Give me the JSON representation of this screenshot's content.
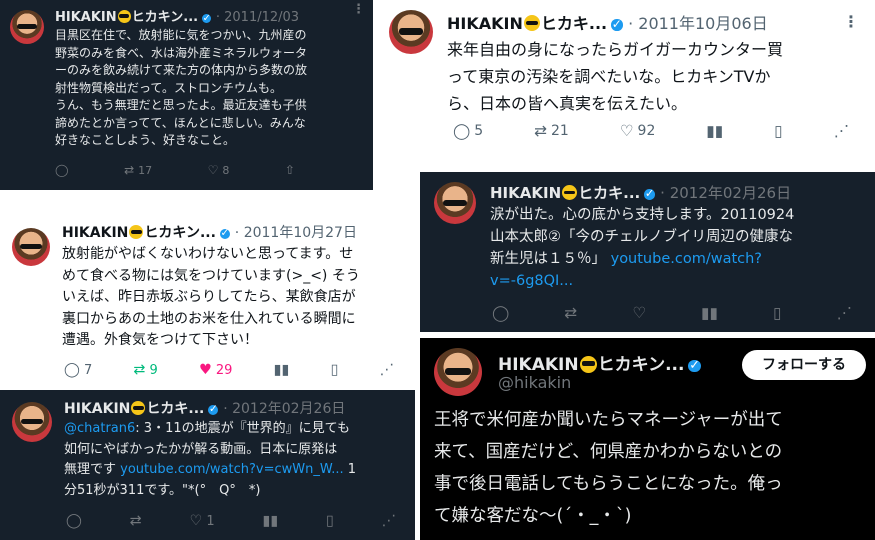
{
  "tweets": [
    {
      "name": "HIKAKIN",
      "name_suffix": "ヒカキン...",
      "date": "2011/12/03",
      "lines": [
        "目黒区在住で、放射能に気をつかい、九州産の",
        "野菜のみを食べ、水は海外産ミネラルウォータ",
        "ーのみを飲み続けて来た方の体内から多数の放",
        "射性物質検出だって。ストロンチウムも。",
        "うん、もう無理だと思ったよ。最近友達も子供",
        "諦めたとか言ってて、ほんとに悲しい。みんな",
        "好きなことしよう、好きなこと。"
      ],
      "reply": "",
      "retweet": "17",
      "like": "8"
    },
    {
      "name": "HIKAKIN",
      "name_suffix": "ヒカキ...",
      "date": "2011年10月06日",
      "lines": [
        "来年自由の身になったらガイガーカウンター買",
        "って東京の汚染を調べたいな。ヒカキンTVか",
        "ら、日本の皆へ真実を伝えたい。"
      ],
      "reply": "5",
      "retweet": "21",
      "like": "92"
    },
    {
      "name": "HIKAKIN",
      "name_suffix": "ヒカキ...",
      "date": "2012年02月26日",
      "lines": [
        "涙が出た。心の底から支持します。20110924",
        "山本太郎②「今のチェルノブイリ周辺の健康な"
      ],
      "line3_text": "新生児は１５％」 ",
      "line3_link": "youtube.com/watch?",
      "line4_link": "v=-6g8QI...",
      "reply": "",
      "retweet": "",
      "like": ""
    },
    {
      "name": "HIKAKIN",
      "name_suffix": "ヒカキン...",
      "date": "2011年10月27日",
      "lines": [
        "放射能がやばくないわけないと思ってます。せ",
        "めて食べる物には気をつけています(>_<) そう",
        "いえば、昨日赤坂ぶらりしてたら、某飲食店が",
        "裏口からあの土地のお米を仕入れている瞬間に",
        "遭遇。外食気をつけて下さい！"
      ],
      "reply": "7",
      "retweet": "9",
      "like": "29"
    },
    {
      "name": "HIKAKIN",
      "name_suffix": "ヒカキ...",
      "date": "2012年02月26日",
      "mention": "@chatran6",
      "line1_rest": ": 3・11の地震が『世界的』に見ても",
      "line2": "如何にやばかったかが解る動画。日本に原発は",
      "line3_text": "無理です ",
      "line3_link": "youtube.com/watch?v=cwWn_W...",
      "line3_tail": " 1",
      "line4": "分51秒が311です。\"*(°　Q°　*)",
      "reply": "",
      "retweet": "",
      "like": "1"
    },
    {
      "name": "HIKAKIN",
      "name_suffix": "ヒカキン...",
      "handle": "@hikakin",
      "follow": "フォローする",
      "lines": [
        "王将で米何産か聞いたらマネージャーが出て",
        "来て、国産だけど、何県産かわからないとの",
        "事で後日電話してもらうことになった。俺っ",
        "て嫌な客だな〜(´・_・`)"
      ]
    }
  ],
  "colors": {
    "dark_bg": "#16202b",
    "black_bg": "#000000",
    "accent": "#1d9bf0",
    "like_pink": "#f91880",
    "retweet_green": "#00ba7c"
  },
  "icons": [
    "reply-icon",
    "retweet-icon",
    "heart-icon",
    "views-icon",
    "bookmark-icon",
    "share-icon",
    "verified-icon",
    "sunglasses-emoji-icon",
    "more-icon"
  ]
}
